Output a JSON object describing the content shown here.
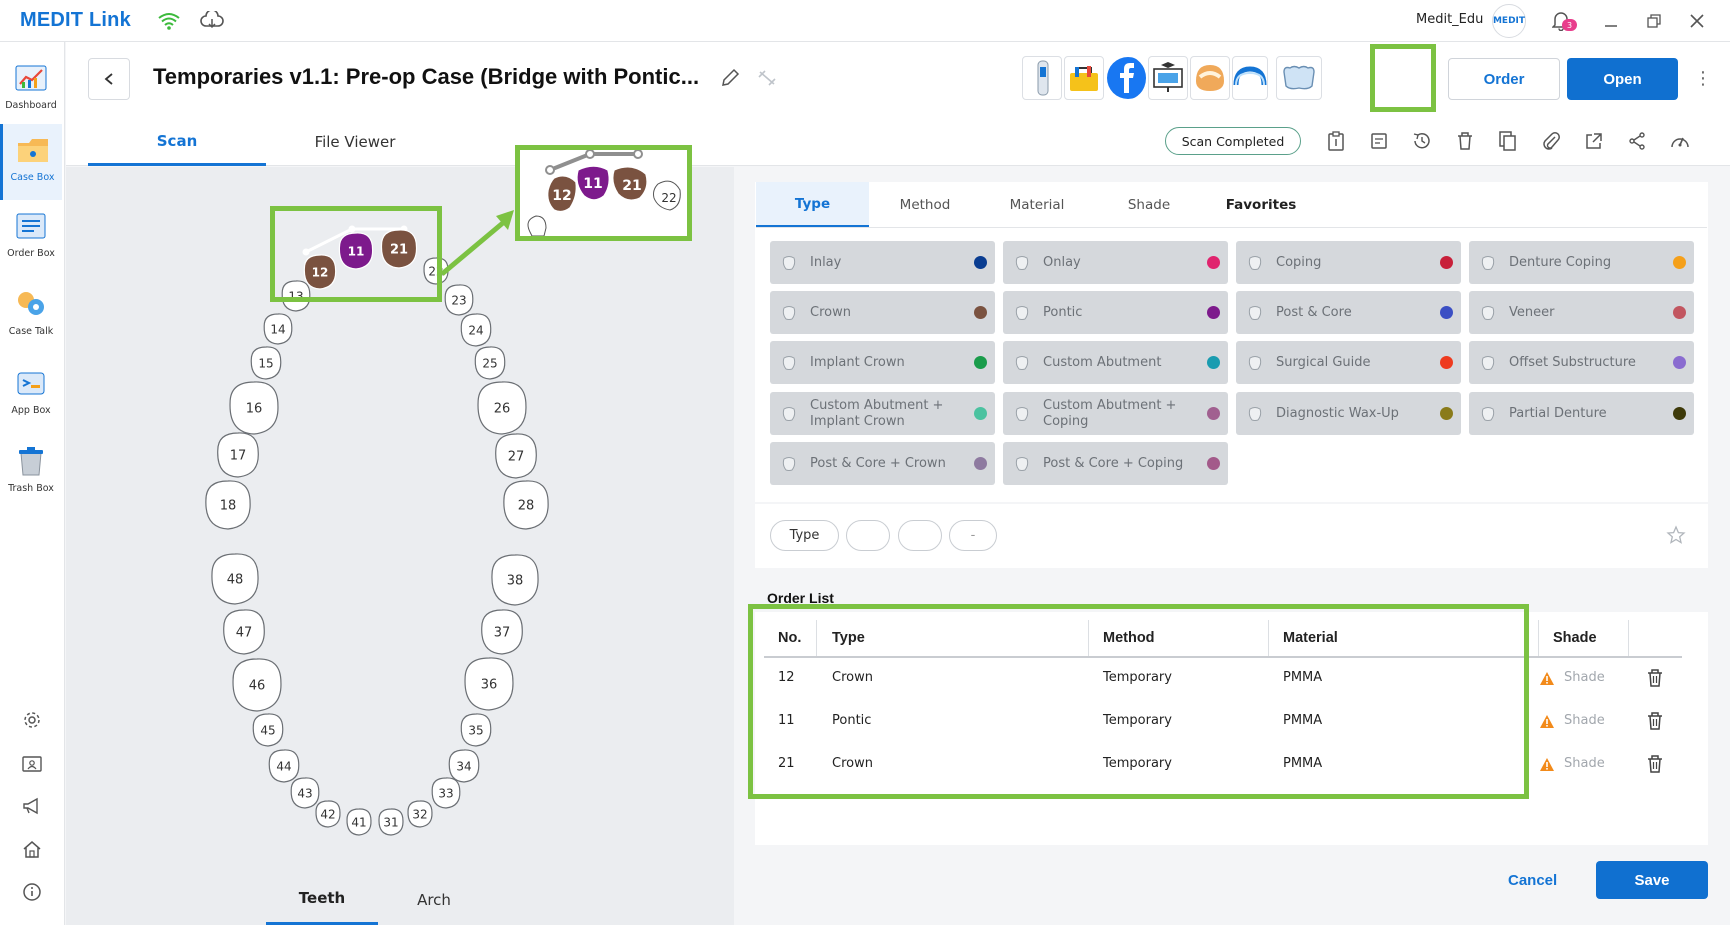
{
  "app": {
    "logo": "MEDIT Link",
    "user": "Medit_Edu",
    "badge": "MEDIT",
    "notif_count": "3"
  },
  "sidebar": {
    "items": [
      {
        "label": "Dashboard"
      },
      {
        "label": "Case Box"
      },
      {
        "label": "Order Box"
      },
      {
        "label": "Case Talk"
      },
      {
        "label": "App Box"
      },
      {
        "label": "Trash Box"
      }
    ]
  },
  "header": {
    "title": "Temporaries v1.1: Pre-op Case (Bridge with Pontic...",
    "order_label": "Order",
    "open_label": "Open",
    "tabs": [
      "Scan",
      "File Viewer"
    ],
    "status": "Scan Completed"
  },
  "chart": {
    "teeth_upper": [
      "13",
      "14",
      "15",
      "16",
      "17",
      "18",
      "22",
      "23",
      "24",
      "25",
      "26",
      "27",
      "28"
    ],
    "teeth_selected": [
      {
        "n": "12",
        "type": "Crown",
        "color": "#7a5240"
      },
      {
        "n": "11",
        "type": "Pontic",
        "color": "#7d1a8c"
      },
      {
        "n": "21",
        "type": "Crown",
        "color": "#7a5240"
      }
    ],
    "teeth_lower": [
      "48",
      "47",
      "46",
      "45",
      "44",
      "43",
      "42",
      "41",
      "31",
      "32",
      "33",
      "34",
      "35",
      "36",
      "37",
      "38"
    ],
    "bottom_tabs": [
      "Teeth",
      "Arch"
    ]
  },
  "type_tabs": [
    "Type",
    "Method",
    "Material",
    "Shade",
    "Favorites"
  ],
  "types": [
    {
      "label": "Inlay",
      "color": "#0a3d91"
    },
    {
      "label": "Onlay",
      "color": "#e0246e"
    },
    {
      "label": "Coping",
      "color": "#c8203a"
    },
    {
      "label": "Denture Coping",
      "color": "#f5a01a"
    },
    {
      "label": "Crown",
      "color": "#7a5240"
    },
    {
      "label": "Pontic",
      "color": "#7d1a8c"
    },
    {
      "label": "Post & Core",
      "color": "#3b4fc4"
    },
    {
      "label": "Veneer",
      "color": "#c25660"
    },
    {
      "label": "Implant Crown",
      "color": "#1a9c4b"
    },
    {
      "label": "Custom Abutment",
      "color": "#1a9cb0"
    },
    {
      "label": "Surgical Guide",
      "color": "#ee3b1f"
    },
    {
      "label": "Offset Substructure",
      "color": "#8a6cd0"
    },
    {
      "label": "Custom Abutment + Implant Crown",
      "color": "#4bc2a0"
    },
    {
      "label": "Custom Abutment + Coping",
      "color": "#a16090"
    },
    {
      "label": "Diagnostic Wax-Up",
      "color": "#8a7b1a"
    },
    {
      "label": "Partial Denture",
      "color": "#3e3a0a"
    },
    {
      "label": "Post & Core + Crown",
      "color": "#8e7aa0"
    },
    {
      "label": "Post & Core + Coping",
      "color": "#a35a8a"
    }
  ],
  "filter": {
    "chips": [
      "Type",
      "",
      "",
      "-"
    ]
  },
  "order_list": {
    "title": "Order List",
    "headers": [
      "No.",
      "Type",
      "Method",
      "Material",
      "Shade"
    ],
    "rows": [
      {
        "no": "12",
        "type": "Crown",
        "method": "Temporary",
        "material": "PMMA",
        "shade": "Shade"
      },
      {
        "no": "11",
        "type": "Pontic",
        "method": "Temporary",
        "material": "PMMA",
        "shade": "Shade"
      },
      {
        "no": "21",
        "type": "Crown",
        "method": "Temporary",
        "material": "PMMA",
        "shade": "Shade"
      }
    ]
  },
  "footer": {
    "cancel": "Cancel",
    "save": "Save"
  }
}
